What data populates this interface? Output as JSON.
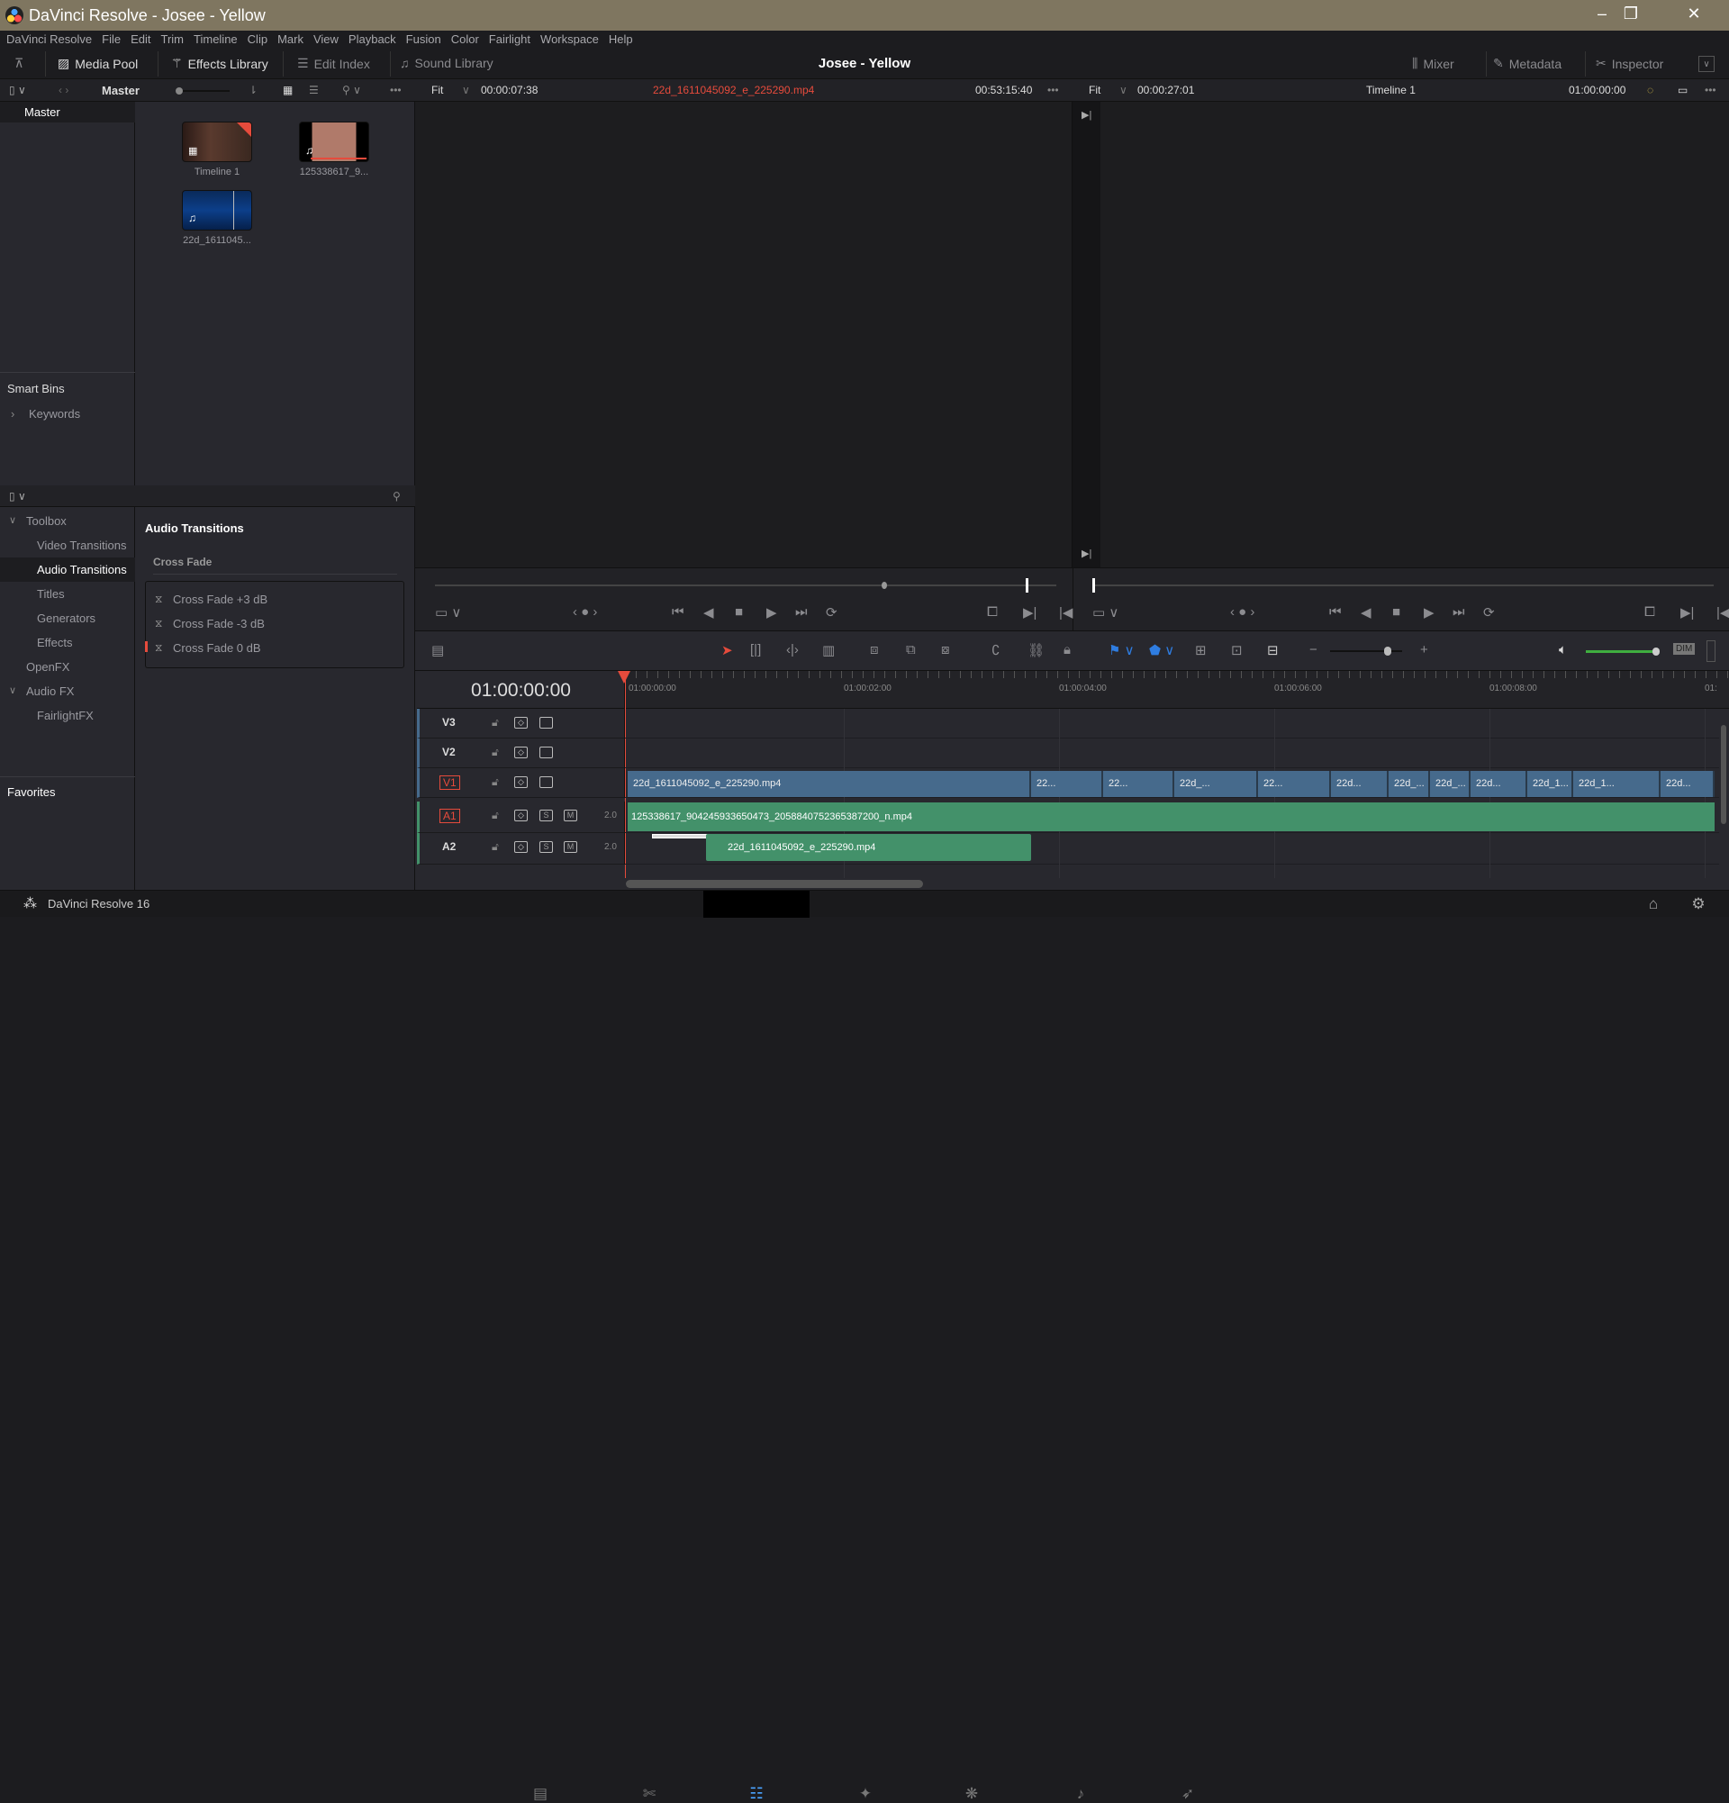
{
  "window": {
    "title": "DaVinci Resolve - Josee - Yellow",
    "minimize": "–",
    "maximize": "❐",
    "close": "✕"
  },
  "menu": [
    "DaVinci Resolve",
    "File",
    "Edit",
    "Trim",
    "Timeline",
    "Clip",
    "Mark",
    "View",
    "Playback",
    "Fusion",
    "Color",
    "Fairlight",
    "Workspace",
    "Help"
  ],
  "toolbar": {
    "media_pool": "Media Pool",
    "effects_library": "Effects Library",
    "edit_index": "Edit Index",
    "sound_library": "Sound Library",
    "project_title": "Josee - Yellow",
    "mixer": "Mixer",
    "metadata": "Metadata",
    "inspector": "Inspector"
  },
  "media_pool": {
    "bin": "Master",
    "bins": [
      "Master"
    ],
    "smart_bins": "Smart Bins",
    "keywords": "Keywords",
    "clips": [
      {
        "name": "Timeline 1",
        "type": "timeline"
      },
      {
        "name": "125338617_9...",
        "type": "audio-video"
      },
      {
        "name": "22d_1611045...",
        "type": "audio-video"
      }
    ]
  },
  "source_viewer": {
    "zoom": "Fit",
    "duration": "00:00:07:38",
    "clip": "22d_1611045092_e_225290.mp4",
    "timecode": "00:53:15:40",
    "playhead": 0.95
  },
  "timeline_viewer": {
    "zoom": "Fit",
    "duration": "00:00:27:01",
    "timeline": "Timeline 1",
    "timecode": "01:00:00:00",
    "playhead": 0.0
  },
  "effects": {
    "tree": [
      {
        "label": "Toolbox",
        "expanded": true,
        "level": 0
      },
      {
        "label": "Video Transitions",
        "level": 1
      },
      {
        "label": "Audio Transitions",
        "level": 1,
        "selected": true
      },
      {
        "label": "Titles",
        "level": 1
      },
      {
        "label": "Generators",
        "level": 1
      },
      {
        "label": "Effects",
        "level": 1
      },
      {
        "label": "OpenFX",
        "level": 0
      },
      {
        "label": "Audio FX",
        "expanded": true,
        "level": 0
      },
      {
        "label": "FairlightFX",
        "level": 1
      }
    ],
    "favorites": "Favorites",
    "section": "Audio Transitions",
    "group": "Cross Fade",
    "items": [
      "Cross Fade +3 dB",
      "Cross Fade -3 dB",
      "Cross Fade 0 dB"
    ]
  },
  "timeline": {
    "timecode": "01:00:00:00",
    "ruler": [
      "01:00:00:00",
      "01:00:02:00",
      "01:00:04:00",
      "01:00:06:00",
      "01:00:08:00",
      "01:"
    ],
    "tracks": [
      {
        "name": "V3"
      },
      {
        "name": "V2"
      },
      {
        "name": "V1",
        "active": true
      },
      {
        "name": "A1",
        "active": true,
        "level": "2.0"
      },
      {
        "name": "A2",
        "level": "2.0"
      }
    ],
    "solo": "S",
    "mute": "M",
    "dim": "DIM",
    "v1_clips": [
      "22d_1611045092_e_225290.mp4",
      "22...",
      "22...",
      "22d_...",
      "22...",
      "22d...",
      "22d_...",
      "22d_...",
      "22d...",
      "22d_1...",
      "22d_1...",
      "22d..."
    ],
    "a1_clip": "125338617_904245933650473_2058840752365387200_n.mp4",
    "a2_clip": "22d_1611045092_e_225290.mp4",
    "volume": 0.95,
    "zoom_level": 0.75
  },
  "footer": {
    "app": "DaVinci Resolve 16",
    "pages": [
      "media",
      "cut",
      "edit",
      "fusion",
      "color",
      "fairlight",
      "deliver"
    ],
    "active_page": "edit"
  },
  "colors": {
    "titlebar": "#7f7660",
    "video_clip": "#466a8c",
    "audio_clip": "#43916a",
    "playhead": "#e64b3c",
    "clip_name_red": "#e64b3c"
  }
}
